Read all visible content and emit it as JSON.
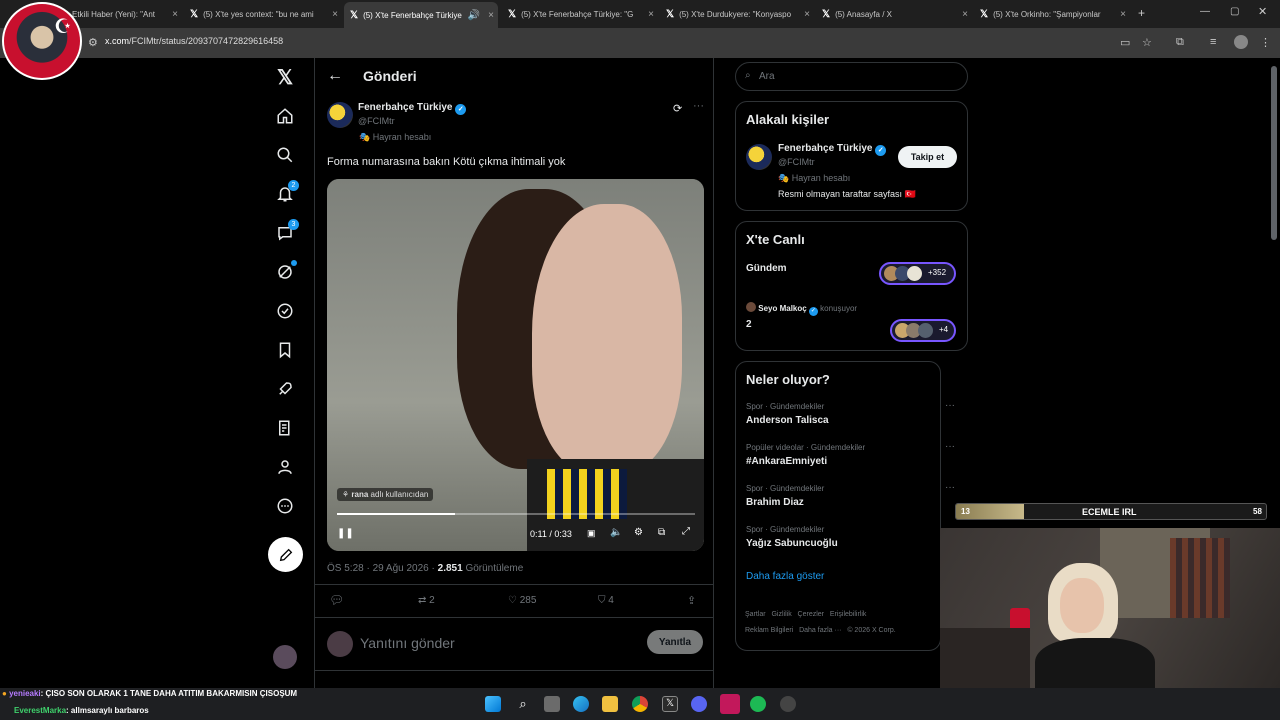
{
  "tabs": [
    {
      "label": "Etkili Haber (Yeni): \"Ant"
    },
    {
      "label": "(5) X'te yes context: \"bu ne ami"
    },
    {
      "label": "(5) X'te Fenerbahçe Türkiye"
    },
    {
      "label": "(5) X'te Fenerbahçe Türkiye: \"G"
    },
    {
      "label": "(5) X'te Durdukyere: \"Konyaspo"
    },
    {
      "label": "(5) Anasayfa / X"
    },
    {
      "label": "(5) X'te Orkinho: \"Şampiyonlar"
    }
  ],
  "url": {
    "host": "x.com",
    "path": "/FCIMtr/status/2093707472829616458"
  },
  "nav": {
    "notifications_badge": "2",
    "messages_badge": "3"
  },
  "header": {
    "title": "Gönderi"
  },
  "post": {
    "author": "Fenerbahçe Türkiye",
    "handle": "@FCIMtr",
    "fan_label": "Hayran hesabı",
    "text": "Forma numarasına bakın Kötü çıkma ihtimali yok",
    "video": {
      "credit_user": "rana",
      "credit_suffix": "adlı kullanıcıdan",
      "time": "0:11 / 0:33",
      "progress": 0.33
    },
    "timestamp": "ÖS 5:28 · 29 Ağu 2026 ·",
    "views": "2.851",
    "views_label": "Görüntüleme",
    "reposts": "2",
    "likes": "285",
    "bookmarks": "4"
  },
  "reply": {
    "placeholder": "Yanıtını gönder",
    "button": "Yanıtla"
  },
  "search": {
    "placeholder": "Ara"
  },
  "related": {
    "title": "Alakalı kişiler",
    "name": "Fenerbahçe Türkiye",
    "handle": "@FCIMtr",
    "fan_label": "Hayran hesabı",
    "bio": "Resmi olmayan taraftar sayfası 🇹🇷",
    "follow": "Takip et"
  },
  "live": {
    "title": "X'te Canlı",
    "item1": {
      "label": "Gündem",
      "count": "+352"
    },
    "item2": {
      "host": "Seyo Malkoç",
      "host_suffix": "konuşuyor",
      "label": "2",
      "count": "+4"
    }
  },
  "trends": {
    "title": "Neler oluyor?",
    "items": [
      {
        "meta": "Spor · Gündemdekiler",
        "name": "Anderson Talisca"
      },
      {
        "meta": "Popüler videolar · Gündemdekiler",
        "name": "#AnkaraEmniyeti"
      },
      {
        "meta": "Spor · Gündemdekiler",
        "name": "Brahim Diaz"
      },
      {
        "meta": "Spor · Gündemdekiler",
        "name": "Yağız Sabuncuoğlu"
      }
    ],
    "more": "Daha fazla göster"
  },
  "footer": {
    "links": [
      "Şartlar",
      "Gizlilik",
      "Çerezler",
      "Erişilebilirlik",
      "Reklam Bilgileri",
      "Daha fazla ···",
      "© 2026 X Corp."
    ]
  },
  "overlay": {
    "bar_left": "13",
    "bar_title": "ECEMLE IRL",
    "bar_right": "58",
    "bar_progress": 0.22,
    "chat1_user": "yenieaki",
    "chat1_text": ": ÇISO SON OLARAK 1 TANE DAHA ATITIM BAKARMISIN ÇISOŞUM",
    "chat2_user": "EverestMarka",
    "chat2_text": ": allmsaraylı barbaros"
  }
}
